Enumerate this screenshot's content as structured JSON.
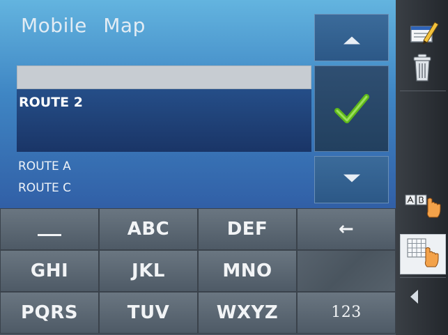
{
  "header": {
    "title": "Mobile Map"
  },
  "list": {
    "input_value": "",
    "selected_item": "ROUTE 2",
    "items": [
      "ROUTE A",
      "ROUTE C"
    ]
  },
  "keyboard": {
    "rows": [
      [
        "_",
        "ABC",
        "DEF",
        "←"
      ],
      [
        "GHI",
        "JKL",
        "MNO",
        ""
      ],
      [
        "PQRS",
        "TUV",
        "WXYZ",
        "123"
      ]
    ]
  },
  "icons": {
    "scroll_up": "triangle-up-icon",
    "confirm": "checkmark-icon",
    "scroll_down": "triangle-down-icon",
    "edit": "edit-note-icon",
    "delete": "trash-can-icon",
    "alphabetic_mode": "ab-keyboard-icon",
    "keypad_mode": "keypad-grid-icon",
    "back": "back-arrow-icon"
  },
  "colors": {
    "accent_check": "#5fb81a",
    "header_gradient_top": "#63b4df",
    "selected_row": "#1f4178"
  }
}
